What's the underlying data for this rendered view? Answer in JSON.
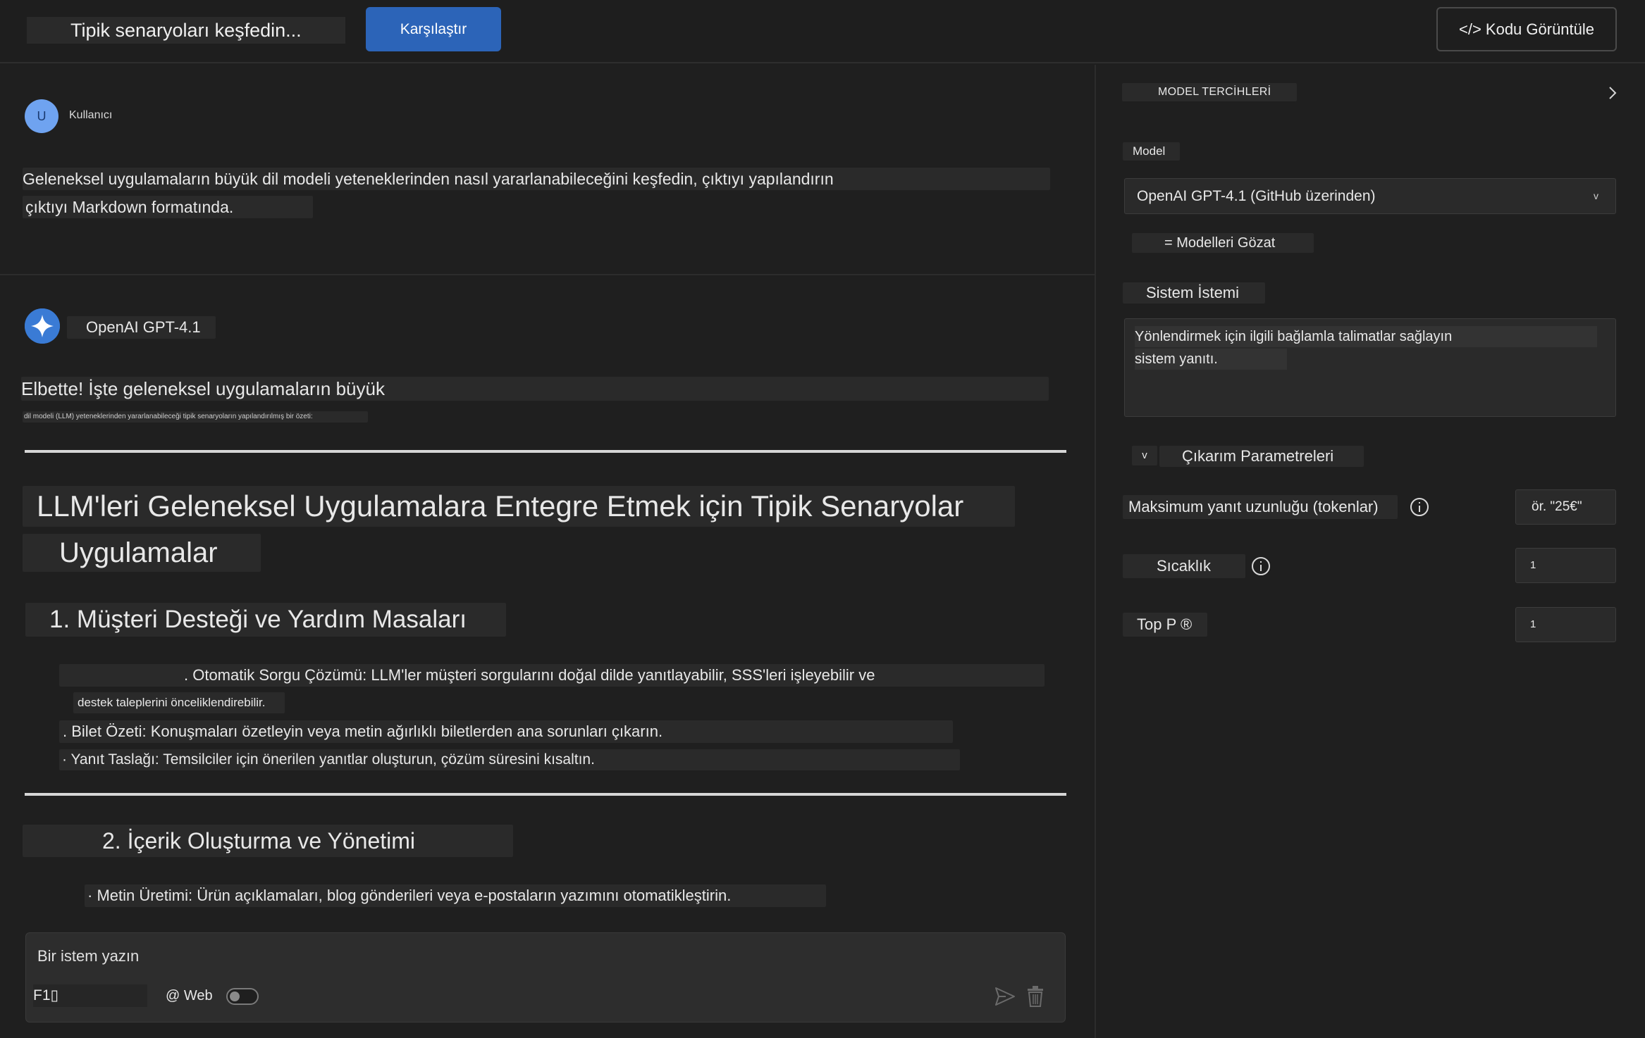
{
  "topbar": {
    "scenario_text": "Tipik senaryoları keşfedin...",
    "compare_label": "Karşılaştır",
    "view_code_label": "</> Kodu Görüntüle"
  },
  "chat": {
    "user": {
      "avatar_letter": "U",
      "name": "Kullanıcı",
      "message_line1": "Geleneksel uygulamaların büyük dil modeli yeteneklerinden nasıl yararlanabileceğini keşfedin, çıktıyı yapılandırın",
      "message_line2": "çıktıyı Markdown formatında."
    },
    "assistant": {
      "name": "OpenAI GPT-4.1",
      "intro": "Elbette! İşte geleneksel uygulamaların büyük",
      "intro_sub": "dil modeli (LLM) yeteneklerinden yararlanabileceği tipik senaryoların yapılandırılmış bir özeti:",
      "heading_line1": "LLM'leri Geleneksel Uygulamalara Entegre Etmek için Tipik Senaryolar",
      "heading_line2": "Uygulamalar",
      "section1_title": "1. Müşteri Desteği ve Yardım Masaları",
      "section1_b1_line1": ". Otomatik Sorgu Çözümü: LLM'ler müşteri sorgularını doğal dilde yanıtlayabilir, SSS'leri işleyebilir ve",
      "section1_b1_line2": "destek taleplerini önceliklendirebilir.",
      "section1_b2": ". Bilet Özeti: Konuşmaları özetleyin veya metin ağırlıklı biletlerden ana sorunları çıkarın.",
      "section1_b3": "· Yanıt Taslağı: Temsilciler için önerilen yanıtlar oluşturun, çözüm süresini kısaltın.",
      "section2_title": "2. İçerik Oluşturma ve Yönetimi",
      "section2_b1": "· Metin Üretimi: Ürün açıklamaları, blog gönderileri veya e-postaların yazımını otomatikleştirin."
    }
  },
  "prompt": {
    "placeholder": "Bir istem yazın",
    "f1_label": "F1▯",
    "web_label": "@ Web",
    "web_toggle_on": false
  },
  "settings": {
    "title": "MODEL TERCİHLERİ",
    "model_label": "Model",
    "model_value": "OpenAI GPT-4.1 (GitHub üzerinden)",
    "model_chevron": "v",
    "browse_label": "= Modelleri Gözat",
    "system_prompt_label": "Sistem İstemi",
    "system_prompt_line1": "Yönlendirmek için ilgili bağlamla talimatlar sağlayın",
    "system_prompt_line2": "sistem yanıtı.",
    "inference_chevron": "v",
    "inference_label": "Çıkarım Parametreleri",
    "max_tokens_label": "Maksimum yanıt uzunluğu (tokenlar)",
    "max_tokens_placeholder": "ör. \"25€\"",
    "temperature_label": "Sıcaklık",
    "temperature_value": "1",
    "top_p_label": "Top P ®",
    "top_p_value": "1"
  },
  "colors": {
    "accent": "#2c64b8",
    "background": "#1f1f1f",
    "chip": "#2a2a2a"
  }
}
